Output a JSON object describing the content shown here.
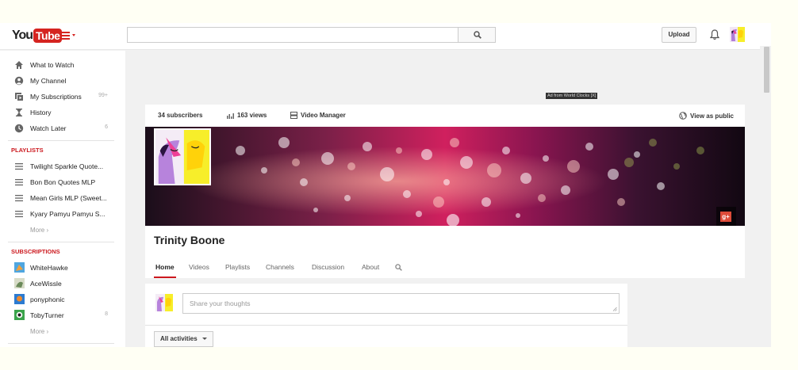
{
  "header": {
    "logo_you": "You",
    "logo_tube": "Tube",
    "search_value": "",
    "upload_label": "Upload",
    "brand_color": "#cc181e"
  },
  "sidebar": {
    "items": [
      {
        "label": "What to Watch",
        "icon": "home-icon",
        "count": ""
      },
      {
        "label": "My Channel",
        "icon": "user-icon",
        "count": ""
      },
      {
        "label": "My Subscriptions",
        "icon": "subscriptions-icon",
        "count": "99+"
      },
      {
        "label": "History",
        "icon": "hourglass-icon",
        "count": ""
      },
      {
        "label": "Watch Later",
        "icon": "clock-icon",
        "count": "6"
      }
    ],
    "playlists_title": "PLAYLISTS",
    "playlists": [
      {
        "label": "Twilight Sparkle Quote..."
      },
      {
        "label": "Bon Bon Quotes MLP"
      },
      {
        "label": "Mean Girls MLP (Sweet..."
      },
      {
        "label": "Kyary Pamyu Pamyu S..."
      }
    ],
    "playlists_more": "More ›",
    "subscriptions_title": "SUBSCRIPTIONS",
    "subscriptions": [
      {
        "label": "WhiteHawke",
        "count": ""
      },
      {
        "label": "AceWissle",
        "count": ""
      },
      {
        "label": "ponyphonic",
        "count": ""
      },
      {
        "label": "TobyTurner",
        "count": "8"
      }
    ],
    "subscriptions_more": "More ›"
  },
  "ad": {
    "label": "Ad from World Clocks [X]"
  },
  "channel": {
    "subscribers": "34 subscribers",
    "views": "163 views",
    "video_manager": "Video Manager",
    "view_as_public": "View as public",
    "name": "Trinity Boone",
    "tabs": [
      {
        "label": "Home",
        "active": true
      },
      {
        "label": "Videos",
        "active": false
      },
      {
        "label": "Playlists",
        "active": false
      },
      {
        "label": "Channels",
        "active": false
      },
      {
        "label": "Discussion",
        "active": false
      },
      {
        "label": "About",
        "active": false
      }
    ],
    "gplus_label": "g+"
  },
  "feed": {
    "share_placeholder": "Share your thoughts",
    "filter_label": "All activities"
  }
}
